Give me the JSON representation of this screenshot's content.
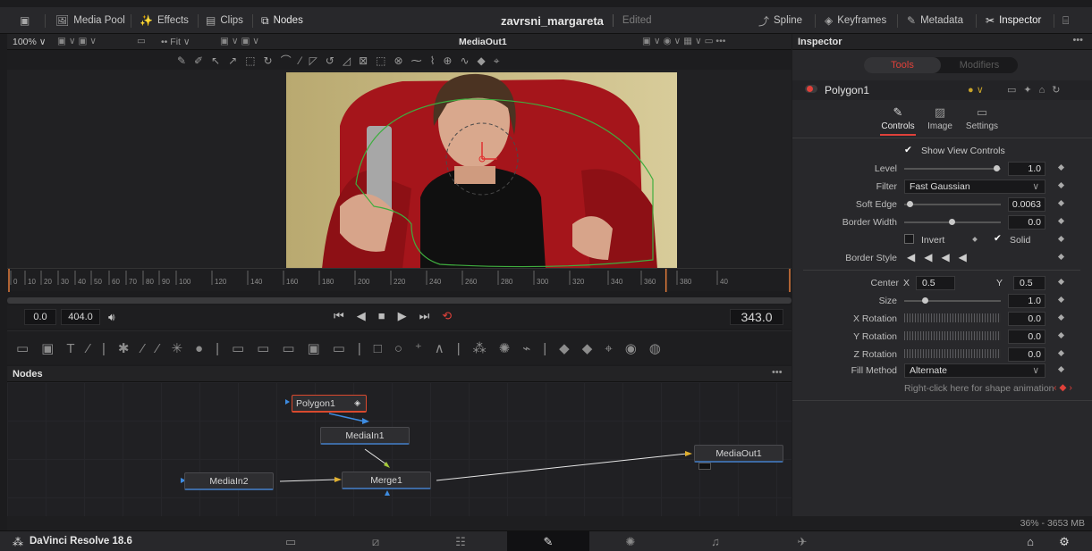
{
  "topbar": {
    "media_pool": "Media Pool",
    "effects": "Effects",
    "clips": "Clips",
    "nodes": "Nodes",
    "project_name": "zavrsni_margareta",
    "project_status": "Edited",
    "spline": "Spline",
    "keyframes": "Keyframes",
    "metadata": "Metadata",
    "inspector": "Inspector"
  },
  "viewer": {
    "zoom": "100%",
    "fit": "Fit",
    "title": "MediaOut1",
    "ruler_ticks": [
      "0",
      "10",
      "20",
      "30",
      "40",
      "50",
      "60",
      "70",
      "80",
      "90",
      "100",
      "120",
      "140",
      "160",
      "180",
      "200",
      "220",
      "240",
      "260",
      "280",
      "300",
      "320",
      "340",
      "360",
      "380",
      "40"
    ],
    "start_frame": "0.0",
    "end_frame": "404.0",
    "current_frame": "343.0",
    "playhead_fraction": 0.84
  },
  "nodes_panel": {
    "title": "Nodes",
    "nodes": {
      "polygon": "Polygon1",
      "mediain1": "MediaIn1",
      "mediain2": "MediaIn2",
      "merge": "Merge1",
      "mediaout": "MediaOut1"
    },
    "memory": "36% - 3653 MB"
  },
  "inspector": {
    "title": "Inspector",
    "tab_tools": "Tools",
    "tab_modifiers": "Modifiers",
    "tool_name": "Polygon1",
    "subtabs": [
      "Controls",
      "Image",
      "Settings"
    ],
    "show_view_controls": "Show View Controls",
    "level_label": "Level",
    "level_value": "1.0",
    "level_fraction": 1.0,
    "filter_label": "Filter",
    "filter_value": "Fast Gaussian",
    "soft_edge_label": "Soft Edge",
    "soft_edge_value": "0.0063",
    "border_width_label": "Border Width",
    "border_width_value": "0.0",
    "invert_label": "Invert",
    "solid_label": "Solid",
    "border_style_label": "Border Style",
    "center_label": "Center",
    "center_x_label": "X",
    "center_x": "0.5",
    "center_y_label": "Y",
    "center_y": "0.5",
    "size_label": "Size",
    "size_value": "1.0",
    "x_rotation_label": "X Rotation",
    "x_rotation_value": "0.0",
    "y_rotation_label": "Y Rotation",
    "y_rotation_value": "0.0",
    "z_rotation_label": "Z Rotation",
    "z_rotation_value": "0.0",
    "fill_method_label": "Fill Method",
    "fill_method_value": "Alternate",
    "shape_anim_hint": "Right-click here for shape animation"
  },
  "bottombar": {
    "app_name": "DaVinci Resolve 18.6"
  },
  "colors": {
    "accent_red": "#e0413a",
    "playhead_orange": "#e07a3a",
    "node_outline_red": "#d94a2e",
    "link_blue": "#3d8be0"
  }
}
